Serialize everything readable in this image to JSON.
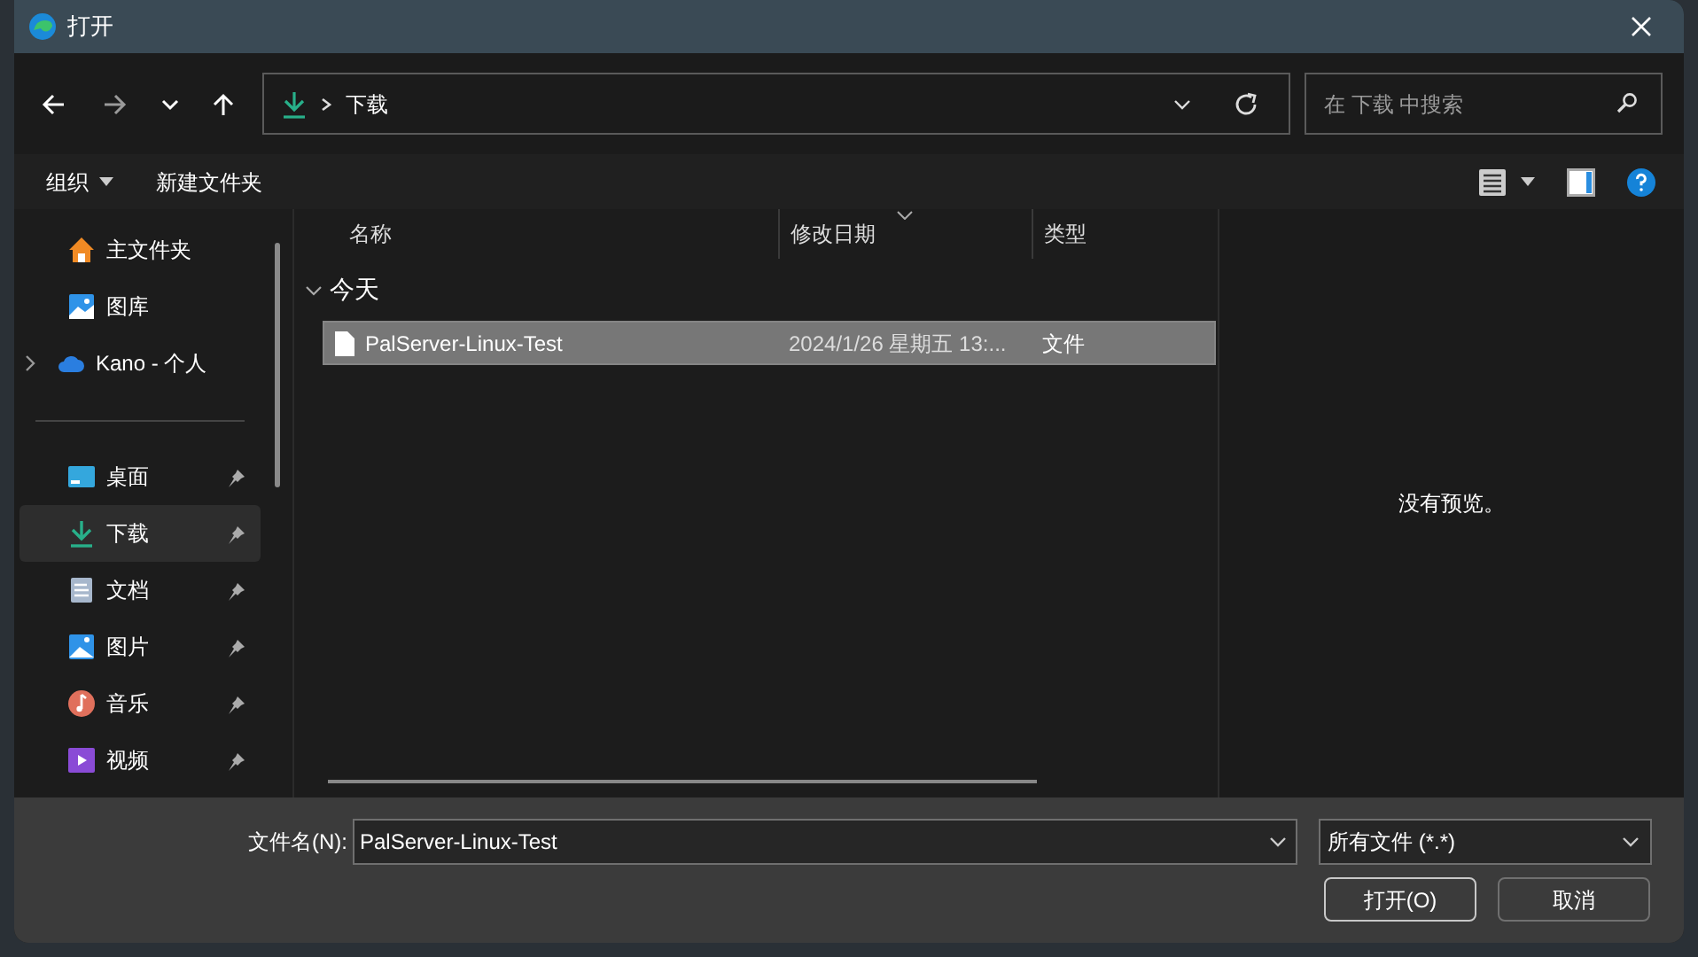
{
  "window": {
    "title": "打开"
  },
  "address": {
    "path": "下载"
  },
  "search": {
    "placeholder": "在 下载 中搜索"
  },
  "toolbar": {
    "items": [
      {
        "label": "组织",
        "kind": "menu"
      },
      {
        "label": "新建文件夹",
        "kind": "plain"
      }
    ]
  },
  "sidebar": {
    "places": [
      {
        "label": "主文件夹",
        "expandable": false
      },
      {
        "label": "图库",
        "expandable": false
      },
      {
        "label": "Kano - 个人",
        "expandable": true
      }
    ],
    "quick_access": [
      {
        "label": "桌面",
        "pinned": true,
        "selected": false
      },
      {
        "label": "下载",
        "pinned": true,
        "selected": true
      },
      {
        "label": "文档",
        "pinned": true,
        "selected": false
      },
      {
        "label": "图片",
        "pinned": true,
        "selected": false
      },
      {
        "label": "音乐",
        "pinned": true,
        "selected": false
      },
      {
        "label": "视频",
        "pinned": true,
        "selected": false
      }
    ]
  },
  "table": {
    "columns": [
      "名称",
      "修改日期",
      "类型"
    ],
    "groups": [
      {
        "label": "今天",
        "expanded": true,
        "rows": [
          {
            "name": "PalServer-Linux-Test",
            "date": "2024/1/26 星期五 13:...",
            "type": "文件",
            "selected": true
          }
        ]
      }
    ]
  },
  "preview": {
    "text": "没有预览。"
  },
  "footer": {
    "filename_label": "文件名(N):",
    "filename": "PalServer-Linux-Test",
    "filetype": "所有文件 (*.*)",
    "buttons": [
      {
        "label": "打开(O)",
        "primary": true
      },
      {
        "label": "取消",
        "primary": false
      }
    ]
  }
}
